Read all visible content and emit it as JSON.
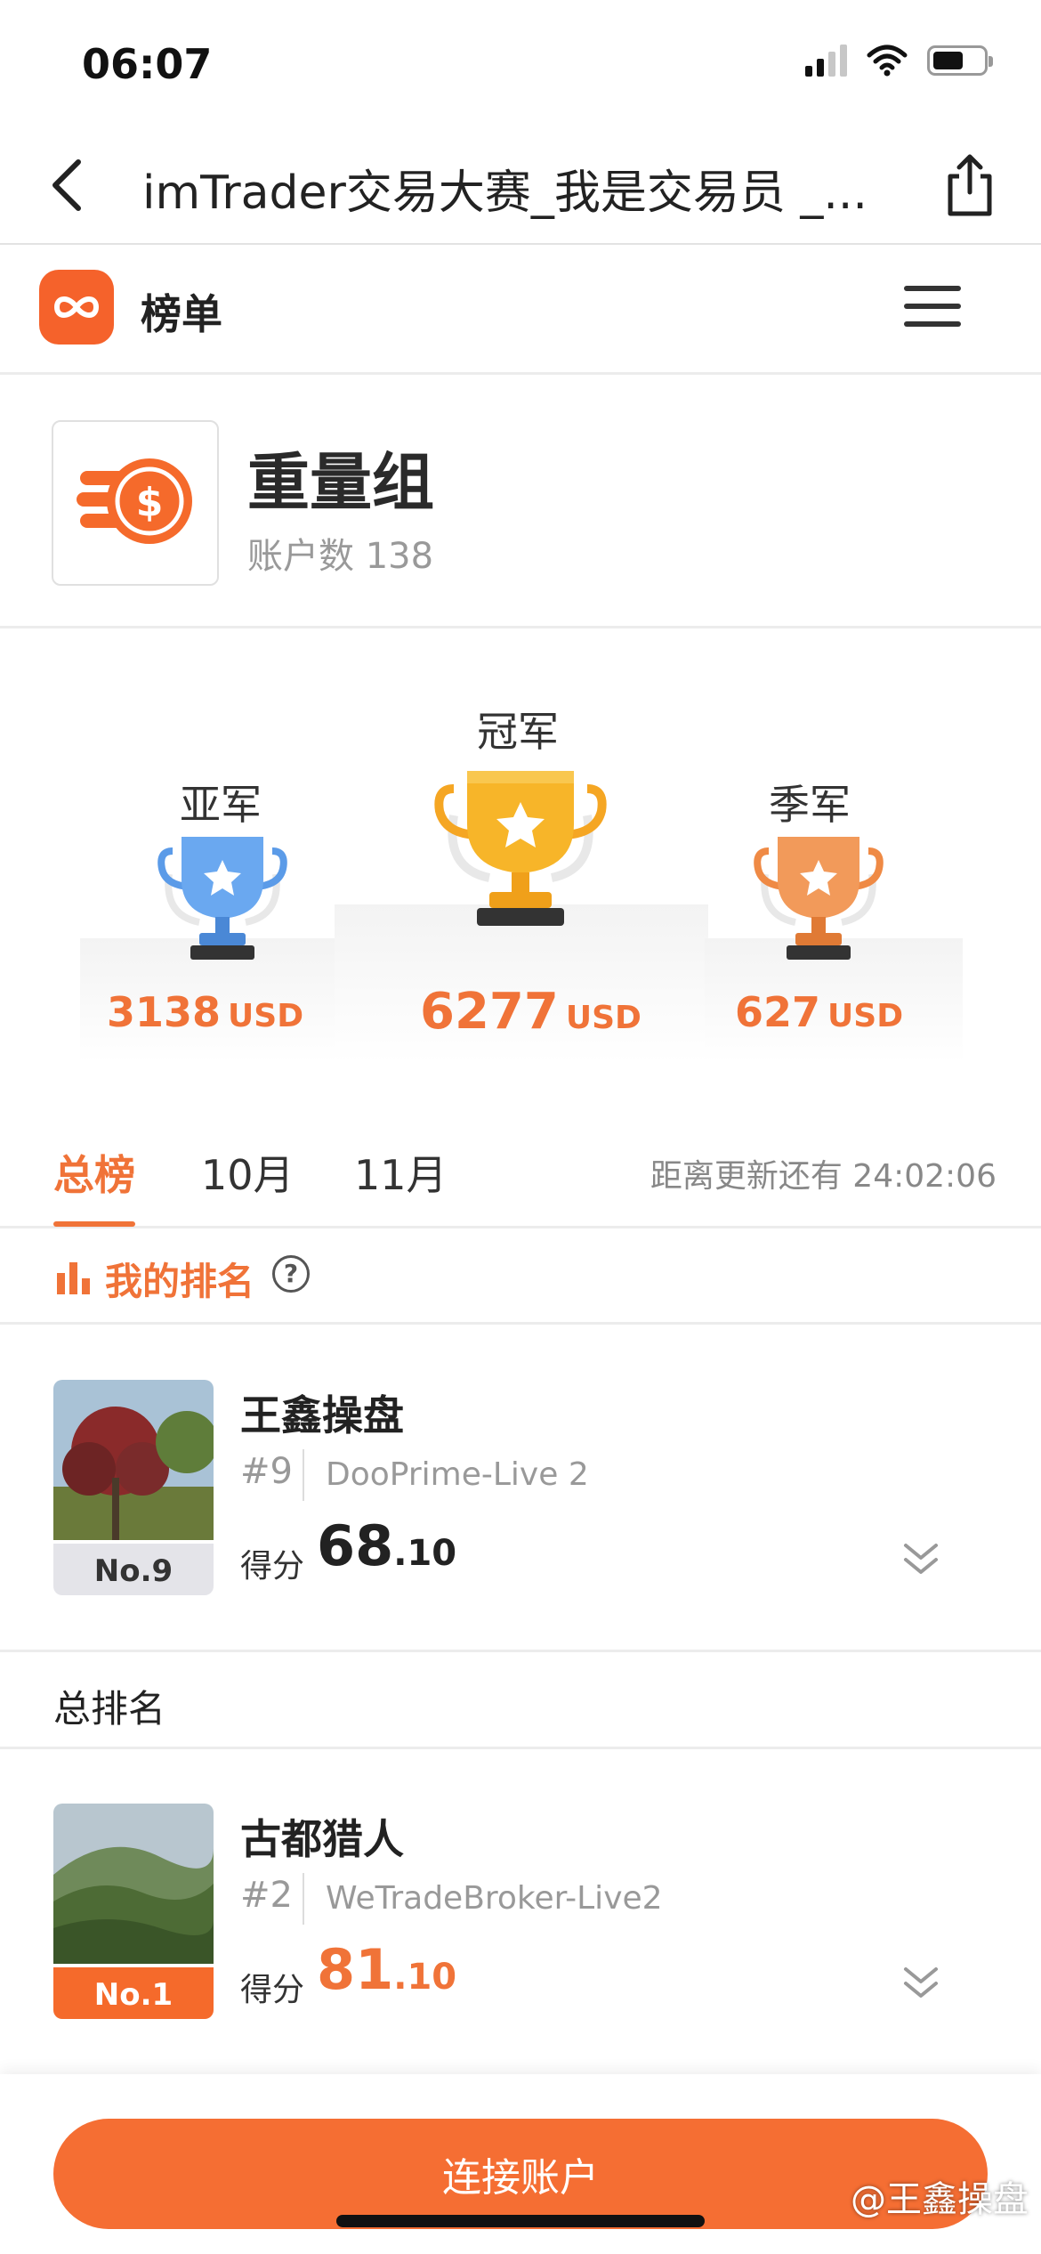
{
  "status_bar": {
    "time": "06:07"
  },
  "nav": {
    "title": "imTrader交易大赛_我是交易员 _..."
  },
  "app": {
    "name": "榜单"
  },
  "group": {
    "title": "重量组",
    "account_count": "账户数 138"
  },
  "podium": {
    "first": {
      "label": "冠军",
      "amount": "6277",
      "currency": "USD"
    },
    "second": {
      "label": "亚军",
      "amount": "3138",
      "currency": "USD"
    },
    "third": {
      "label": "季军",
      "amount": "627",
      "currency": "USD"
    }
  },
  "tabs": [
    {
      "label": "总榜",
      "active": true
    },
    {
      "label": "10月",
      "active": false
    },
    {
      "label": "11月",
      "active": false
    }
  ],
  "update_countdown": "距离更新还有 24:02:06",
  "my_rank": {
    "heading": "我的排名",
    "name": "王鑫操盘",
    "rank": "#9",
    "server": "DooPrime-Live 2",
    "score_label": "得分",
    "score_int": "68",
    "score_dec": ".10",
    "tag": "No.9"
  },
  "overall_heading": "总排名",
  "leaderboard": [
    {
      "name": "古都猎人",
      "rank": "#2",
      "server": "WeTradeBroker-Live2",
      "score_label": "得分",
      "score_int": "81",
      "score_dec": ".10",
      "tag": "No.1"
    }
  ],
  "connect_button": "连接账户",
  "watermark": "@王鑫操盘",
  "colors": {
    "accent": "#f07338",
    "gold": "#f5a623",
    "silver": "#5b9be8",
    "bronze": "#ef8a45"
  }
}
